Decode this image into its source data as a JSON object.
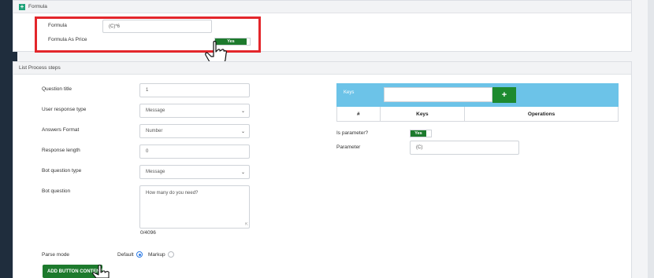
{
  "formula_section": {
    "title": "Formula",
    "formula_label": "Formula",
    "formula_value": "(C)*6",
    "as_price_label": "Formula As Price",
    "as_price_toggle": "Yes"
  },
  "list_section": {
    "title": "List Process steps",
    "question_title_label": "Question title",
    "question_title_value": "1",
    "user_response_type_label": "User response type",
    "user_response_type_value": "Message",
    "answers_format_label": "Answers Format",
    "answers_format_value": "Number",
    "response_length_label": "Response length",
    "response_length_value": "0",
    "bot_question_type_label": "Bot question type",
    "bot_question_type_value": "Message",
    "bot_question_label": "Bot question",
    "bot_question_value": "How many do you need?",
    "char_counter": "0/4096",
    "parse_mode_label": "Parse mode",
    "parse_mode_options": [
      "Default",
      "Markup"
    ],
    "parse_mode_selected": "Default",
    "add_button_label": "ADD BUTTON CONTENT"
  },
  "keys": {
    "label": "Keys",
    "add_icon": "+",
    "columns": [
      "#",
      "Keys",
      "Operations"
    ],
    "is_parameter_label": "Is parameter?",
    "is_parameter_toggle": "Yes",
    "parameter_label": "Parameter",
    "parameter_value": "(C)"
  },
  "colors": {
    "accent_green": "#1d7a2d",
    "keys_bar_blue": "#6cc3e8",
    "highlight_red": "#e3262b",
    "radio_blue": "#2d7be5"
  }
}
